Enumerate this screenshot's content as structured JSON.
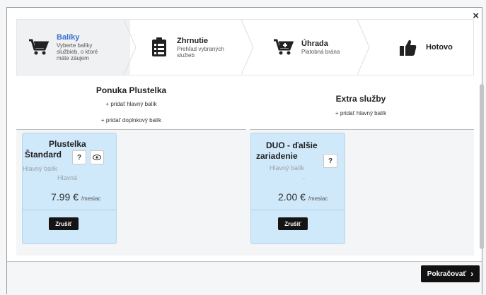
{
  "steps": [
    {
      "title": "Balíky",
      "sub": "Vyberte balíky službieb, o ktoré máte záujem",
      "icon": "cart-icon"
    },
    {
      "title": "Zhrnutie",
      "sub": "Prehľad vybraných služieb",
      "icon": "clipboard-icon"
    },
    {
      "title": "Úhrada",
      "sub": "Platobná brána",
      "icon": "cart-plus-icon"
    },
    {
      "title": "Hotovo",
      "sub": "",
      "icon": "thumbs-up-icon"
    }
  ],
  "left_column": {
    "title": "Ponuka Plustelka",
    "add_main": "+ pridať hlavný balík",
    "add_extra": "+ pridať doplnkový balík"
  },
  "right_column": {
    "title": "Extra služby",
    "add_main": "+ pridať hlavný balík"
  },
  "cards": [
    {
      "name_line1": "Plustelka",
      "name_line2": "Štandard",
      "q": "?",
      "sub1": "Hlavný balík",
      "sub2": "Hlavná",
      "price": "7.99 €",
      "period": "/mesiac",
      "cancel": "Zrušiť"
    },
    {
      "name_line1": "DUO - ďalšie",
      "name_line2": "zariadenie",
      "q": "?",
      "sub1": "Hlavný balík",
      "sub2": "-",
      "price": "2.00 €",
      "period": "/mesiac",
      "cancel": "Zrušiť"
    }
  ],
  "close_glyph": "×",
  "continue_label": "Pokračovať",
  "continue_arrow": "›"
}
